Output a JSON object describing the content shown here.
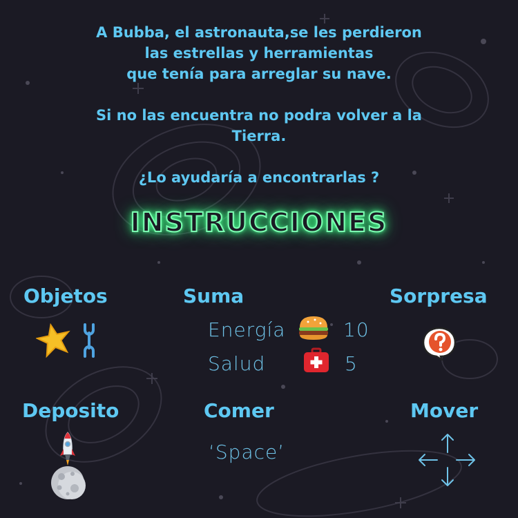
{
  "story": {
    "line1": "A Bubba, el astronauta,se les perdieron\nlas estrellas y herramientas\nque tenía para arreglar su nave.",
    "line2": "Si no las encuentra no podra volver a la\nTierra.",
    "line3": "¿Lo ayudaría a encontrarlas ?"
  },
  "title": "INSTRUCCIONES",
  "sections": {
    "objetos": {
      "heading": "Objetos",
      "icons": [
        "star-icon",
        "wrench-icon"
      ]
    },
    "suma": {
      "heading": "Suma",
      "rows": [
        {
          "label": "Energía",
          "icon": "burger-icon",
          "value": "10"
        },
        {
          "label": "Salud",
          "icon": "first-aid-icon",
          "value": "5"
        }
      ]
    },
    "sorpresa": {
      "heading": "Sorpresa",
      "icon": "question-bubble-icon"
    },
    "deposito": {
      "heading": "Deposito",
      "icons": [
        "rocket-icon",
        "moon-icon"
      ]
    },
    "comer": {
      "heading": "Comer",
      "key": "‘Space’"
    },
    "mover": {
      "heading": "Mover",
      "icon": "arrows-icon"
    }
  },
  "colors": {
    "background": "#1b1a24",
    "text": "#5ec8f2",
    "glow": "#39ff83"
  }
}
